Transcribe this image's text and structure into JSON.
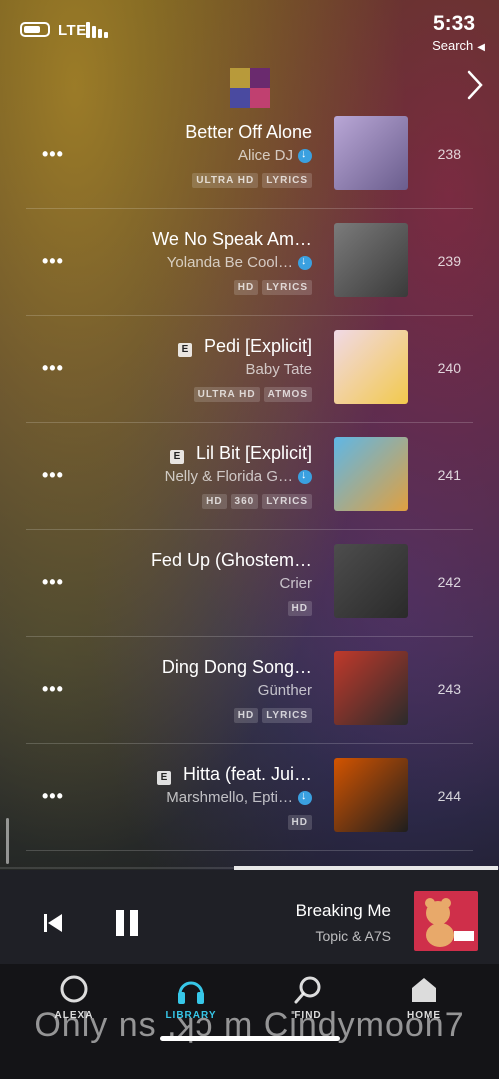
{
  "status_bar": {
    "time": "5:33",
    "network": "LTE",
    "back_label": "Search",
    "battery_level": 0.62
  },
  "rows": [
    {
      "rank": "238",
      "title": "Better Off Alone",
      "artist": "Alice DJ",
      "downloaded": true,
      "explicit": false,
      "badges": [
        "ULTRA HD",
        "LYRICS"
      ],
      "art_colors": [
        "#b9a7d6",
        "#6a5d8d"
      ]
    },
    {
      "rank": "239",
      "title": "We No Speak Am…",
      "artist": "Yolanda Be Cool…",
      "downloaded": true,
      "explicit": false,
      "badges": [
        "HD",
        "LYRICS"
      ],
      "art_colors": [
        "#7b7b7b",
        "#3a3a3a"
      ]
    },
    {
      "rank": "240",
      "title": "Pedi [Explicit]",
      "artist": "Baby Tate",
      "downloaded": false,
      "explicit": true,
      "badges": [
        "ULTRA HD",
        "ATMOS"
      ],
      "art_colors": [
        "#f1d9e6",
        "#f2c94c"
      ]
    },
    {
      "rank": "241",
      "title": "Lil Bit [Explicit]",
      "artist": "Nelly & Florida G…",
      "downloaded": true,
      "explicit": true,
      "badges": [
        "HD",
        "360",
        "LYRICS"
      ],
      "art_colors": [
        "#5fb7e6",
        "#e0a040"
      ]
    },
    {
      "rank": "242",
      "title": "Fed Up (Ghostem…",
      "artist": "Crier",
      "downloaded": false,
      "explicit": false,
      "badges": [
        "HD"
      ],
      "art_colors": [
        "#4d4d4d",
        "#2a2a2a"
      ]
    },
    {
      "rank": "243",
      "title": "Ding Dong Song…",
      "artist": "Günther",
      "downloaded": false,
      "explicit": false,
      "badges": [
        "HD",
        "LYRICS"
      ],
      "art_colors": [
        "#c0392b",
        "#2b2b2b"
      ]
    },
    {
      "rank": "244",
      "title": "Hitta (feat. Jui…",
      "artist": "Marshmello, Epti…",
      "downloaded": true,
      "explicit": true,
      "badges": [
        "HD"
      ],
      "art_colors": [
        "#d35400",
        "#1e1e1e"
      ]
    }
  ],
  "explicit_label": "E",
  "more_label": "•••",
  "now_playing": {
    "title": "Breaking Me",
    "artist": "Topic & A7S",
    "progress": 0.47
  },
  "tabs": [
    {
      "label": "HOME",
      "icon": "home-icon",
      "active": false
    },
    {
      "label": "FIND",
      "icon": "search-icon",
      "active": false
    },
    {
      "label": "LIBRARY",
      "icon": "headphones-icon",
      "active": true
    },
    {
      "label": "ALEXA",
      "icon": "alexa-icon",
      "active": false
    }
  ],
  "watermark": "Only ns .ʞɔ m Cindymoon7",
  "colors": {
    "accent": "#37c7e8",
    "download": "#3aa0e0",
    "art_now_playing": "#cf2f4a"
  }
}
